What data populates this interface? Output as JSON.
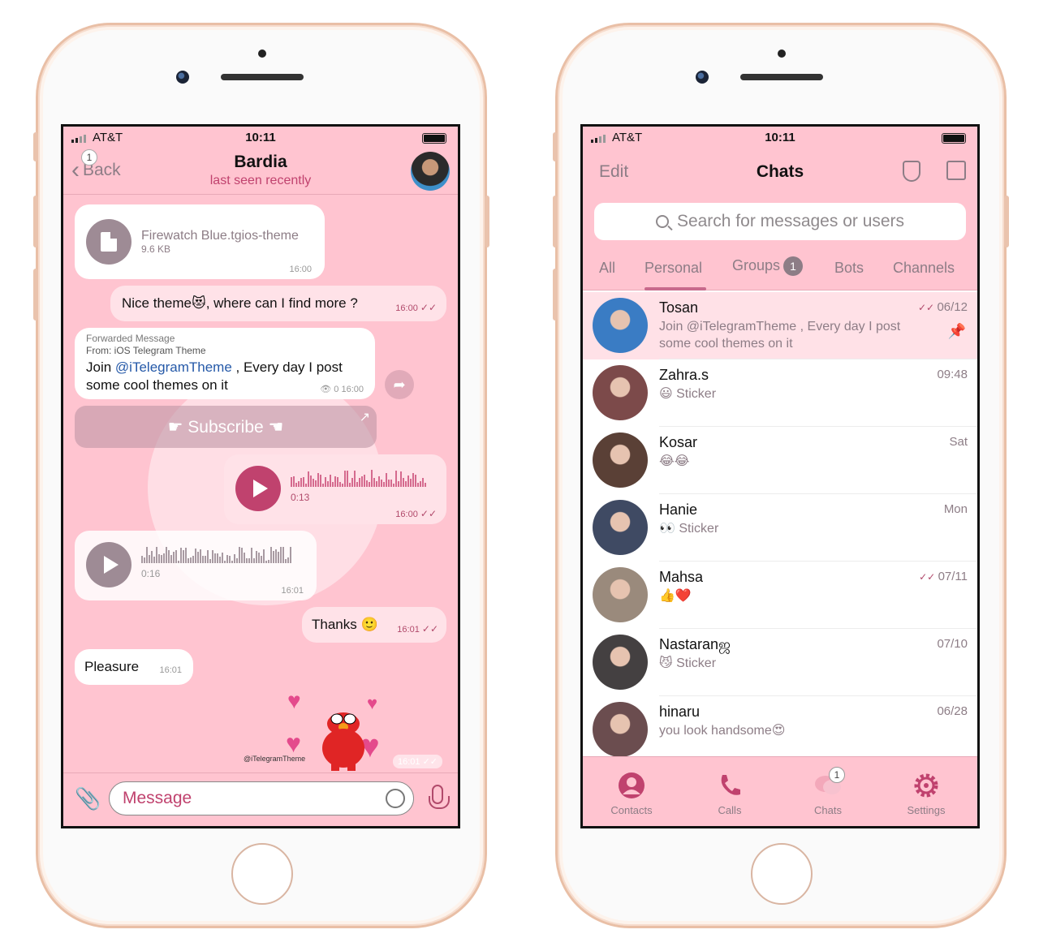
{
  "status": {
    "carrier": "AT&T",
    "time": "10:11"
  },
  "chat": {
    "back_label": "Back",
    "back_badge": "1",
    "title": "Bardia",
    "subtitle": "last seen recently",
    "file": {
      "name": "Firewatch Blue.tgios-theme",
      "size": "9.6 KB",
      "time": "16:00"
    },
    "msg_nice": {
      "text": "Nice theme😻, where can I find more ?",
      "time": "16:00"
    },
    "forwarded": {
      "label": "Forwarded Message",
      "from": "From:  iOS Telegram Theme",
      "text_before": "Join ",
      "link": "@iTelegramTheme",
      "text_after": " , Every day I post some cool themes on it",
      "views": "0",
      "time": "16:00"
    },
    "subscribe_label": "☛ Subscribe ☚",
    "voice_out": {
      "duration": "0:13",
      "time": "16:00"
    },
    "voice_in": {
      "duration": "0:16",
      "time": "16:01"
    },
    "msg_thanks": {
      "text": "Thanks 🙂",
      "time": "16:01"
    },
    "msg_pleasure": {
      "text": "Pleasure",
      "time": "16:01"
    },
    "sticker": {
      "tag": "@iTelegramTheme",
      "time": "16:01"
    },
    "input_placeholder": "Message"
  },
  "chats": {
    "edit_label": "Edit",
    "title": "Chats",
    "search_placeholder": "Search for messages or users",
    "tabs": [
      {
        "label": "All"
      },
      {
        "label": "Personal"
      },
      {
        "label": "Groups",
        "count": "1"
      },
      {
        "label": "Bots"
      },
      {
        "label": "Channels"
      }
    ],
    "rows": [
      {
        "name": "Tosan",
        "preview": "Join @iTelegramTheme , Every day I post some cool themes on it",
        "date": "06/12",
        "read": true,
        "pinned": true,
        "avatar_color": "#3a7cc4"
      },
      {
        "name": "Zahra.s",
        "preview": "😃 Sticker",
        "date": "09:48",
        "avatar_color": "#7c4a4a"
      },
      {
        "name": "Kosar",
        "preview": "😂😂",
        "date": "Sat",
        "avatar_color": "#5a4036"
      },
      {
        "name": "Hanie",
        "preview": "👀 Sticker",
        "date": "Mon",
        "avatar_color": "#3f4a63"
      },
      {
        "name": "Mahsa",
        "preview": "👍❤️",
        "date": "07/11",
        "read": true,
        "avatar_color": "#9a8a7c"
      },
      {
        "name": "Nastaranஜ",
        "preview": "😼 Sticker",
        "date": "07/10",
        "avatar_color": "#444041"
      },
      {
        "name": "hinaru",
        "preview": "you look handsome😍",
        "date": "06/28",
        "avatar_color": "#6b4d4f"
      }
    ],
    "tabbar": [
      {
        "label": "Contacts",
        "icon": "person-circle-icon"
      },
      {
        "label": "Calls",
        "icon": "phone-icon"
      },
      {
        "label": "Chats",
        "icon": "chat-bubbles-icon",
        "badge": "1"
      },
      {
        "label": "Settings",
        "icon": "gear-icon"
      }
    ]
  },
  "colors": {
    "accent": "#c0426e",
    "header_bg": "#ffc4d0",
    "muted": "#8d7d86"
  }
}
